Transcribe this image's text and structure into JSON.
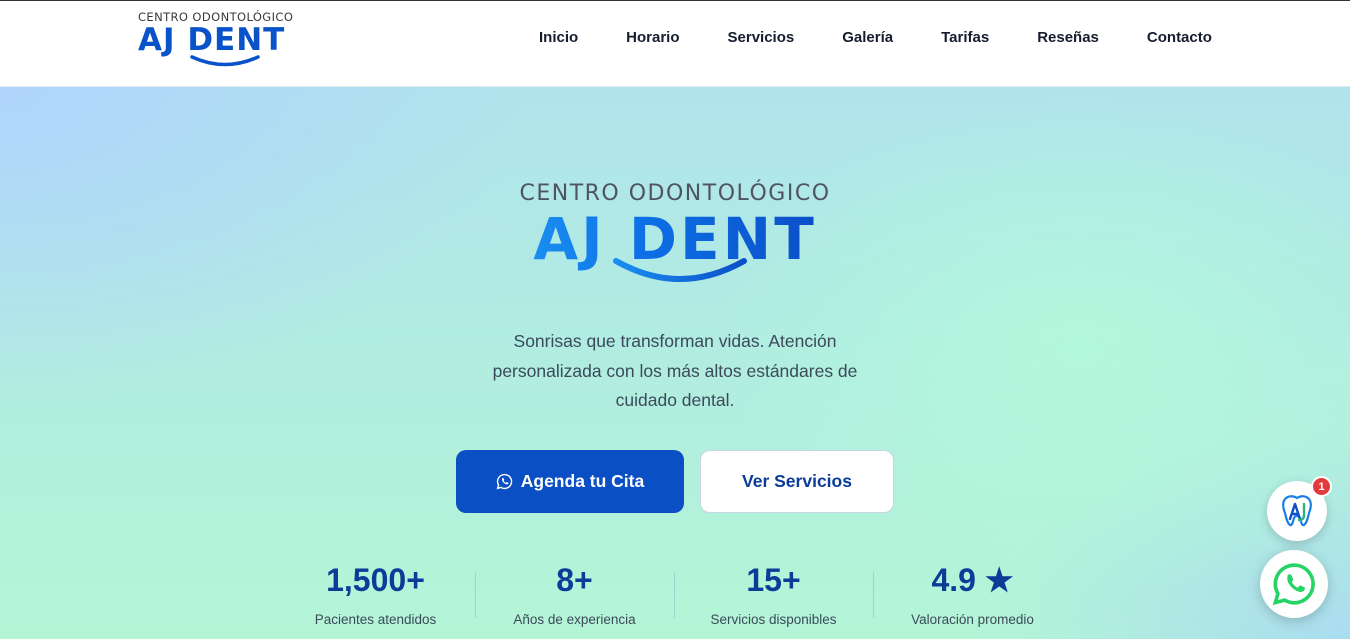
{
  "header": {
    "logo": {
      "kicker": "CENTRO ODONTOLÓGICO",
      "brand": "AJ DENT"
    },
    "nav": [
      {
        "label": "Inicio"
      },
      {
        "label": "Horario"
      },
      {
        "label": "Servicios"
      },
      {
        "label": "Galería"
      },
      {
        "label": "Tarifas"
      },
      {
        "label": "Reseñas"
      },
      {
        "label": "Contacto"
      }
    ]
  },
  "hero": {
    "logo": {
      "kicker": "CENTRO ODONTOLÓGICO",
      "brand": "AJ DENT"
    },
    "tagline": "Sonrisas que transforman vidas. Atención personalizada con los más altos estándares de cuidado dental.",
    "primary_button": {
      "label": "Agenda tu Cita",
      "icon": "whatsapp-icon"
    },
    "secondary_button": {
      "label": "Ver Servicios"
    },
    "stats": [
      {
        "value": "1,500+",
        "label": "Pacientes atendidos"
      },
      {
        "value": "8+",
        "label": "Años de experiencia"
      },
      {
        "value": "15+",
        "label": "Servicios disponibles"
      },
      {
        "value": "4.9 ★",
        "label": "Valoración promedio"
      }
    ]
  },
  "floating": {
    "chat_badge": "1",
    "chat_icon": "aj-tooth-logo-icon",
    "whatsapp_icon": "whatsapp-icon"
  },
  "colors": {
    "brand_blue": "#0a52c9",
    "primary_button": "#0a4fc4",
    "stat_number": "#0b3c97",
    "whatsapp_green": "#25d366",
    "badge_red": "#e33b3b"
  }
}
